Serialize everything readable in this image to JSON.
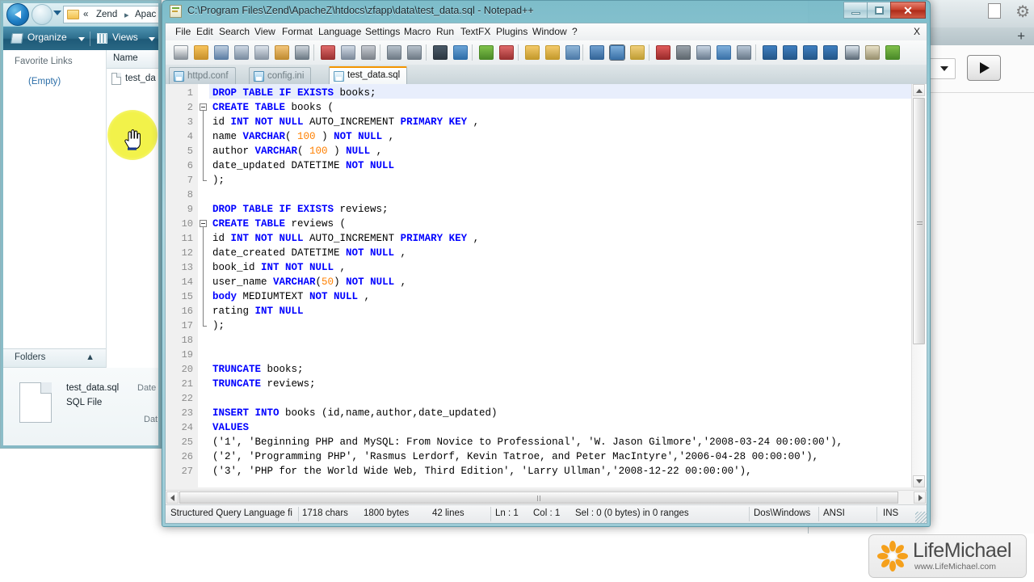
{
  "explorer": {
    "window_name": "windows-explorer",
    "breadcrumbs": [
      "«",
      "Zend",
      "▸",
      "Apac"
    ],
    "toolbar": {
      "organize_label": "Organize",
      "views_label": "Views"
    },
    "left_pane": {
      "favorite_links_title": "Favorite Links",
      "empty_label": "(Empty)",
      "folders_label": "Folders"
    },
    "file_list": {
      "column_header": "Name",
      "rows": [
        {
          "name": "test_da",
          "icon": "file-icon"
        }
      ]
    },
    "details_pane": {
      "file_name": "test_data.sql",
      "file_type": "SQL File",
      "meta_date_label": "Date",
      "meta_date_label2": "Dat"
    }
  },
  "notepadpp": {
    "window_name": "notepad-plus-plus",
    "title": "C:\\Program Files\\Zend\\ApacheZ\\htdocs\\zfapp\\data\\test_data.sql - Notepad++",
    "window_buttons": {
      "minimize": "minimize-button",
      "maximize": "maximize-button",
      "close_glyph": "✕"
    },
    "menu": [
      "File",
      "Edit",
      "Search",
      "View",
      "Format",
      "Language",
      "Settings",
      "Macro",
      "Run",
      "TextFX",
      "Plugins",
      "Window",
      "?"
    ],
    "menu_close_glyph": "X",
    "toolbar_icons": [
      "new-file-icon",
      "open-file-icon",
      "save-icon",
      "save-all-icon",
      "close-file-icon",
      "close-all-icon",
      "print-icon",
      "cut-icon",
      "copy-icon",
      "paste-icon",
      "undo-icon",
      "redo-icon",
      "find-icon",
      "replace-icon",
      "zoom-in-icon",
      "zoom-out-icon",
      "sync-vertical-icon",
      "sync-horizontal-icon",
      "word-wrap-icon",
      "show-all-chars-icon",
      "indent-guide-icon",
      "user-define-dialog-icon",
      "record-macro-icon",
      "stop-macro-icon",
      "play-macro-icon",
      "play-multiple-macro-icon",
      "save-macro-icon",
      "collapse-all-icon",
      "collapse-level-icon",
      "expand-level-icon",
      "expand-all-icon",
      "run-console-icon",
      "document-map-icon",
      "spellcheck-icon"
    ],
    "tabs": [
      {
        "label": "httpd.conf",
        "active": false
      },
      {
        "label": "config.ini",
        "active": false
      },
      {
        "label": "test_data.sql",
        "active": true
      }
    ],
    "editor": {
      "lines": [
        {
          "n": 1,
          "tokens": [
            {
              "t": "DROP TABLE IF EXISTS ",
              "c": "kw"
            },
            {
              "t": "books;",
              "c": ""
            }
          ]
        },
        {
          "n": 2,
          "tokens": [
            {
              "t": "CREATE TABLE ",
              "c": "kw"
            },
            {
              "t": "books (",
              "c": ""
            }
          ]
        },
        {
          "n": 3,
          "tokens": [
            {
              "t": "id ",
              "c": ""
            },
            {
              "t": "INT NOT NULL ",
              "c": "kw"
            },
            {
              "t": "AUTO_INCREMENT ",
              "c": ""
            },
            {
              "t": "PRIMARY KEY",
              "c": "kw"
            },
            {
              "t": " ,",
              "c": ""
            }
          ]
        },
        {
          "n": 4,
          "tokens": [
            {
              "t": "name ",
              "c": ""
            },
            {
              "t": "VARCHAR",
              "c": "kw"
            },
            {
              "t": "( ",
              "c": ""
            },
            {
              "t": "100",
              "c": "num"
            },
            {
              "t": " ) ",
              "c": ""
            },
            {
              "t": "NOT NULL",
              "c": "kw"
            },
            {
              "t": " ,",
              "c": ""
            }
          ]
        },
        {
          "n": 5,
          "tokens": [
            {
              "t": "author ",
              "c": ""
            },
            {
              "t": "VARCHAR",
              "c": "kw"
            },
            {
              "t": "( ",
              "c": ""
            },
            {
              "t": "100",
              "c": "num"
            },
            {
              "t": " ) ",
              "c": ""
            },
            {
              "t": "NULL",
              "c": "kw"
            },
            {
              "t": " ,",
              "c": ""
            }
          ]
        },
        {
          "n": 6,
          "tokens": [
            {
              "t": "date_updated DATETIME ",
              "c": ""
            },
            {
              "t": "NOT NULL",
              "c": "kw"
            }
          ]
        },
        {
          "n": 7,
          "tokens": [
            {
              "t": ");",
              "c": ""
            }
          ]
        },
        {
          "n": 8,
          "tokens": []
        },
        {
          "n": 9,
          "tokens": [
            {
              "t": "DROP TABLE IF EXISTS ",
              "c": "kw"
            },
            {
              "t": "reviews;",
              "c": ""
            }
          ]
        },
        {
          "n": 10,
          "tokens": [
            {
              "t": "CREATE TABLE ",
              "c": "kw"
            },
            {
              "t": "reviews (",
              "c": ""
            }
          ]
        },
        {
          "n": 11,
          "tokens": [
            {
              "t": "id ",
              "c": ""
            },
            {
              "t": "INT NOT NULL ",
              "c": "kw"
            },
            {
              "t": "AUTO_INCREMENT ",
              "c": ""
            },
            {
              "t": "PRIMARY KEY",
              "c": "kw"
            },
            {
              "t": " ,",
              "c": ""
            }
          ]
        },
        {
          "n": 12,
          "tokens": [
            {
              "t": "date_created DATETIME ",
              "c": ""
            },
            {
              "t": "NOT NULL",
              "c": "kw"
            },
            {
              "t": " ,",
              "c": ""
            }
          ]
        },
        {
          "n": 13,
          "tokens": [
            {
              "t": "book_id ",
              "c": ""
            },
            {
              "t": "INT NOT NULL",
              "c": "kw"
            },
            {
              "t": " ,",
              "c": ""
            }
          ]
        },
        {
          "n": 14,
          "tokens": [
            {
              "t": "user_name ",
              "c": ""
            },
            {
              "t": "VARCHAR",
              "c": "kw"
            },
            {
              "t": "(",
              "c": ""
            },
            {
              "t": "50",
              "c": "num"
            },
            {
              "t": ") ",
              "c": ""
            },
            {
              "t": "NOT NULL",
              "c": "kw"
            },
            {
              "t": " ,",
              "c": ""
            }
          ]
        },
        {
          "n": 15,
          "tokens": [
            {
              "t": "body",
              "c": "kw"
            },
            {
              "t": " MEDIUMTEXT ",
              "c": ""
            },
            {
              "t": "NOT NULL",
              "c": "kw"
            },
            {
              "t": " ,",
              "c": ""
            }
          ]
        },
        {
          "n": 16,
          "tokens": [
            {
              "t": "rating ",
              "c": ""
            },
            {
              "t": "INT NULL",
              "c": "kw"
            }
          ]
        },
        {
          "n": 17,
          "tokens": [
            {
              "t": ");",
              "c": ""
            }
          ]
        },
        {
          "n": 18,
          "tokens": []
        },
        {
          "n": 19,
          "tokens": []
        },
        {
          "n": 20,
          "tokens": [
            {
              "t": "TRUNCATE ",
              "c": "kw"
            },
            {
              "t": "books;",
              "c": ""
            }
          ]
        },
        {
          "n": 21,
          "tokens": [
            {
              "t": "TRUNCATE ",
              "c": "kw"
            },
            {
              "t": "reviews;",
              "c": ""
            }
          ]
        },
        {
          "n": 22,
          "tokens": []
        },
        {
          "n": 23,
          "tokens": [
            {
              "t": "INSERT INTO ",
              "c": "kw"
            },
            {
              "t": "books (id,name,author,date_updated)",
              "c": ""
            }
          ]
        },
        {
          "n": 24,
          "tokens": [
            {
              "t": "VALUES",
              "c": "kw"
            }
          ]
        },
        {
          "n": 25,
          "tokens": [
            {
              "t": "('1', 'Beginning PHP and MySQL: From Novice to Professional', 'W. Jason Gilmore','2008-03-24 00:00:00'),",
              "c": ""
            }
          ]
        },
        {
          "n": 26,
          "tokens": [
            {
              "t": "('2', 'Programming PHP', 'Rasmus Lerdorf, Kevin Tatroe, and Peter MacIntyre','2006-04-28 00:00:00'),",
              "c": ""
            }
          ]
        },
        {
          "n": 27,
          "tokens": [
            {
              "t": "('3', 'PHP for the World Wide Web, Third Edition', 'Larry Ullman','2008-12-22 00:00:00'),",
              "c": ""
            }
          ]
        }
      ],
      "fold_lines": [
        2,
        10
      ]
    },
    "statusbar": {
      "language": "Structured Query Language fi",
      "chars": "1718 chars",
      "bytes": "1800 bytes",
      "lines": "42 lines",
      "ln": "Ln : 1",
      "col": "Col : 1",
      "sel": "Sel : 0 (0 bytes) in 0 ranges",
      "eol": "Dos\\Windows",
      "encoding": "ANSI",
      "insert_mode": "INS"
    }
  },
  "background_window": {
    "name": "background-application-window",
    "plus_label": "+",
    "play_button": "play-button",
    "dropdown": "dropdown-select"
  },
  "logo": {
    "name": "LifeMichael",
    "url": "www.LifeMichael.com"
  },
  "colors": {
    "accent_tab": "#f29400",
    "keyword": "#0000ff",
    "number": "#ff8000",
    "aero_glass": "#9cc9d6",
    "close_red": "#c8402b",
    "highlight_yellow": "#f2f24a"
  }
}
